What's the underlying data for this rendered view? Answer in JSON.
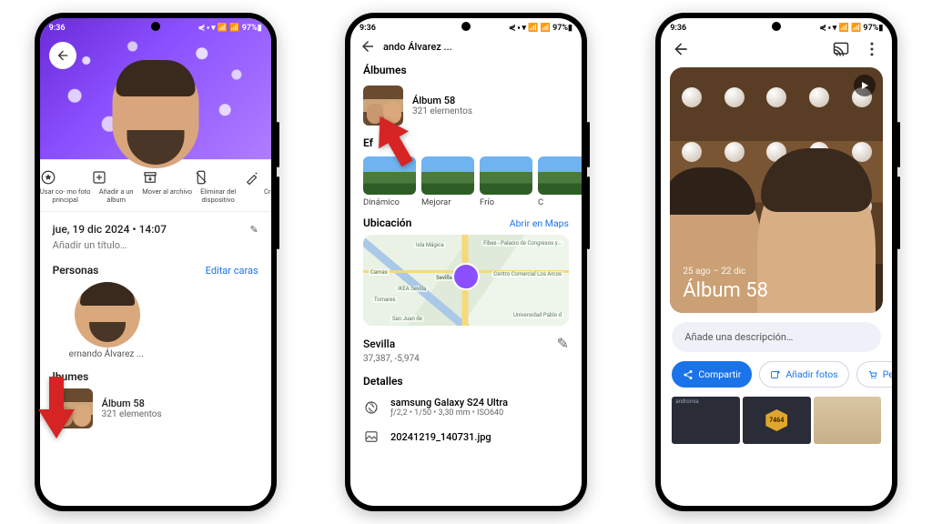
{
  "status": {
    "time": "9:36",
    "icons_text": "◧ ▣ ⋯",
    "right": "⋞ ⬝ ▾ 📶 📶 97%▮"
  },
  "phone1": {
    "back_label": "←",
    "actions": [
      {
        "label": "Usar co-\nmo foto\nprincipal",
        "icon": "star-circle"
      },
      {
        "label": "Añadir a un\nálbum",
        "icon": "plus-square"
      },
      {
        "label": "Mover al\narchivo",
        "icon": "archive-down"
      },
      {
        "label": "Eliminar del\ndispositivo",
        "icon": "trash-slash"
      },
      {
        "label": "Cre",
        "icon": "magic"
      }
    ],
    "date": "jue, 19 dic 2024 • 14:07",
    "edit_icon": "✎",
    "placeholder": "Añadir un título…",
    "people_head": "Personas",
    "edit_faces": "Editar caras",
    "person_name": "ernando Álvarez ...",
    "albums_head": "lbumes",
    "album_name": "Álbum 58",
    "album_count": "321 elementos"
  },
  "phone2": {
    "breadcrumb": "ando Álvarez ...",
    "albums_head": "Álbumes",
    "album_name": "Álbum 58",
    "album_count": "321 elementos",
    "effects_head": "Ef",
    "effects": [
      "Dinámico",
      "Mejorar",
      "Frío",
      "C"
    ],
    "location_head": "Ubicación",
    "open_maps": "Abrir en Maps",
    "map_labels": [
      "Isla Mágica",
      "Camas",
      "Sevilla",
      "Tomares",
      "IKEA Sevilla",
      "San Juan de",
      "Fibes - Palacio de Congresos y...",
      "Centro Comercial Los Arcos",
      "Universidad Pablo d"
    ],
    "city": "Sevilla",
    "coords": "37,387, -5,974",
    "edit_icon": "✎",
    "details_head": "Detalles",
    "device": "samsung Galaxy S24 Ultra",
    "exif": "ƒ/2,2 • 1/50 • 3,30 mm • ISO640",
    "filename": "20241219_140731.jpg"
  },
  "phone3": {
    "date_range": "25 ago – 22 dic",
    "title": "Álbum 58",
    "desc_placeholder": "Añade una descripción…",
    "chips": {
      "share": "Compartir",
      "add": "Añadir fotos",
      "order": "Pe"
    },
    "hex_value": "7464"
  }
}
